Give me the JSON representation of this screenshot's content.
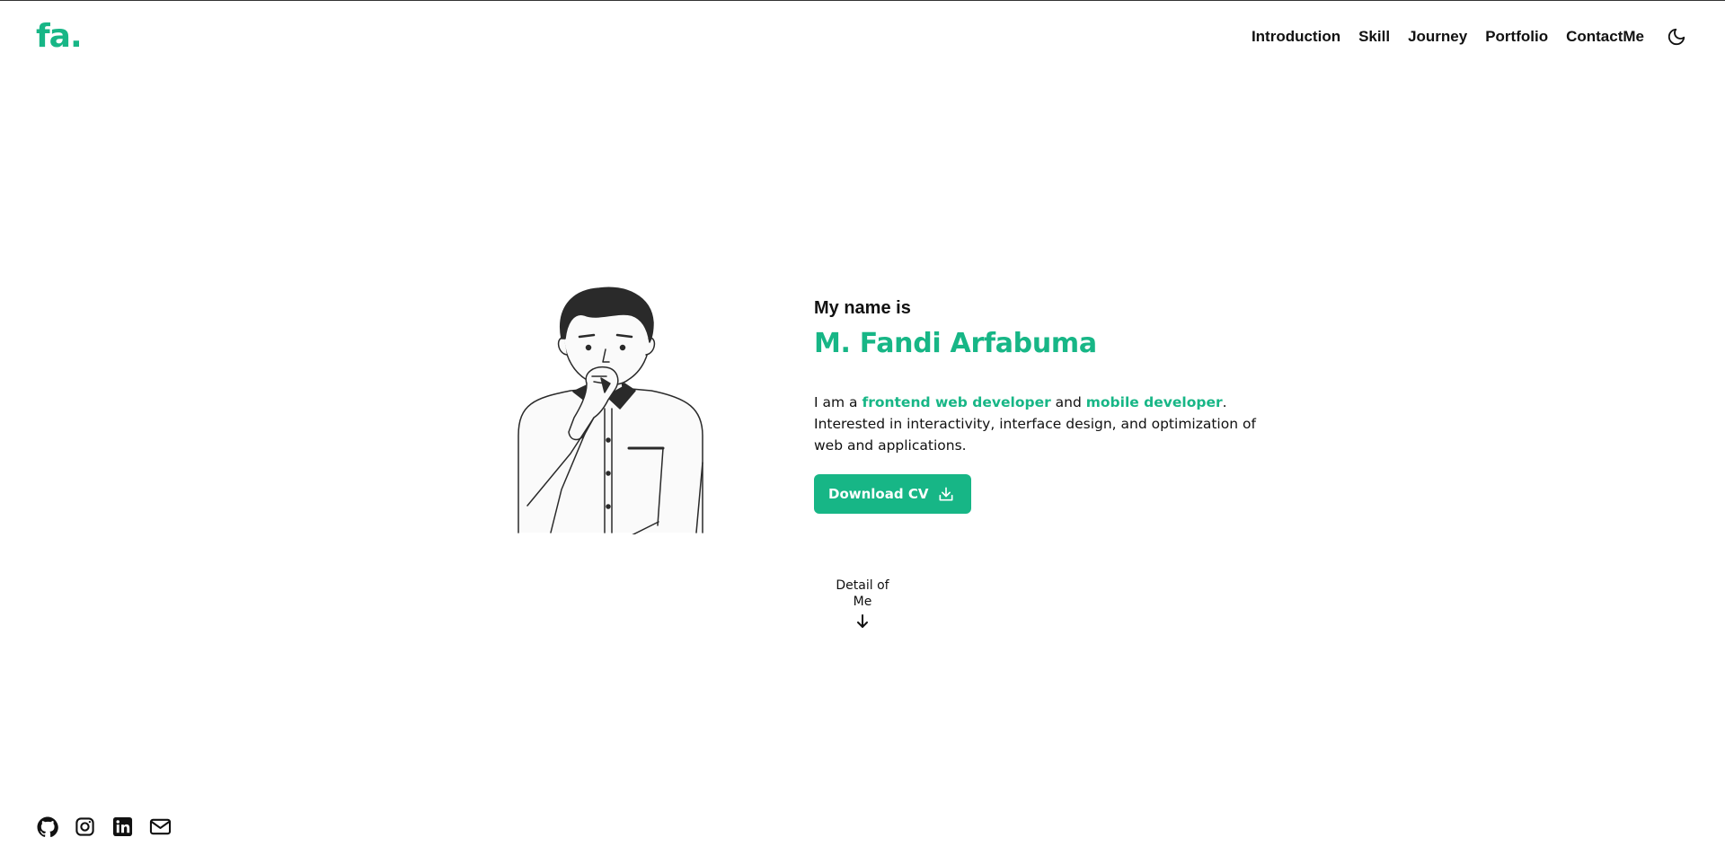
{
  "header": {
    "logo": "fa.",
    "nav": [
      "Introduction",
      "Skill",
      "Journey",
      "Portfolio",
      "ContactMe"
    ],
    "theme_toggle_icon": "moon-icon"
  },
  "hero": {
    "intro_label": "My name is",
    "name": "M. Fandi Arfabuma",
    "bio_prefix": "I am a ",
    "bio_role_1": "frontend web developer",
    "bio_middle": " and ",
    "bio_role_2": "mobile developer",
    "bio_suffix": ".",
    "bio_line_2": "Interested in interactivity, interface design, and optimization of web and applications.",
    "download_label": "Download CV",
    "download_icon": "download-icon"
  },
  "detail": {
    "label": "Detail of Me",
    "icon": "arrow-down-icon"
  },
  "social": {
    "icons": [
      "github-icon",
      "instagram-icon",
      "linkedin-icon",
      "mail-icon"
    ]
  },
  "colors": {
    "accent": "#17b686",
    "text": "#111111",
    "background": "#ffffff"
  }
}
